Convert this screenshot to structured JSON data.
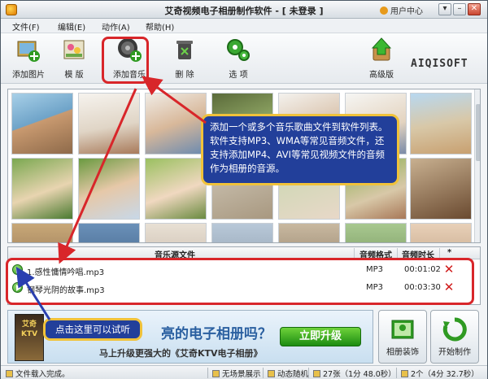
{
  "window": {
    "title": "艾奇视频电子相册制作软件 - [ 未登录 ]",
    "user_center": "用户中心",
    "minimize": "–",
    "settings": "▾",
    "close": "✕"
  },
  "menu": [
    "文件(F)",
    "编辑(E)",
    "动作(A)",
    "帮助(H)"
  ],
  "toolbar": {
    "add_image": "添加图片",
    "template": "模 版",
    "add_music": "添加音乐",
    "delete": "删 除",
    "options": "选 项",
    "advanced": "高级版"
  },
  "logo": "AIQISOFT",
  "callout": {
    "text": "添加一个或多个音乐歌曲文件到软件列表。软件支持MP3、WMA等常见音频文件，还支持添加MP4、AVI等常见视频文件的音频作为相册的音源。"
  },
  "music_list": {
    "columns": [
      "音乐源文件",
      "音频格式",
      "音频时长",
      "*"
    ],
    "rows": [
      {
        "name": "1.感性慵情吟唱.mp3",
        "format": "MP3",
        "duration": "00:01:02"
      },
      {
        "name": "钢琴光阴的故事.mp3",
        "format": "MP3",
        "duration": "00:03:30"
      }
    ]
  },
  "tip": "点击这里可以试听",
  "banner": {
    "box_text": "艾奇 KTV",
    "question": "亮的电子相册吗？",
    "sub": "马上升级更强大的《艾奇KTV电子相册》",
    "upgrade": "立即升级"
  },
  "buttons": {
    "album_decor": "相册装饰",
    "start": "开始制作"
  },
  "status": {
    "message": "文件载入完成。",
    "no_show": "无场景展示",
    "dynamic": "动态随机",
    "images": "27张（1分 48.0秒）",
    "music": "2个（4分 32.7秒）"
  },
  "colors": {
    "callout_bg": "#223f9a",
    "callout_border": "#f0c23a",
    "highlight_red": "#d8262a"
  }
}
